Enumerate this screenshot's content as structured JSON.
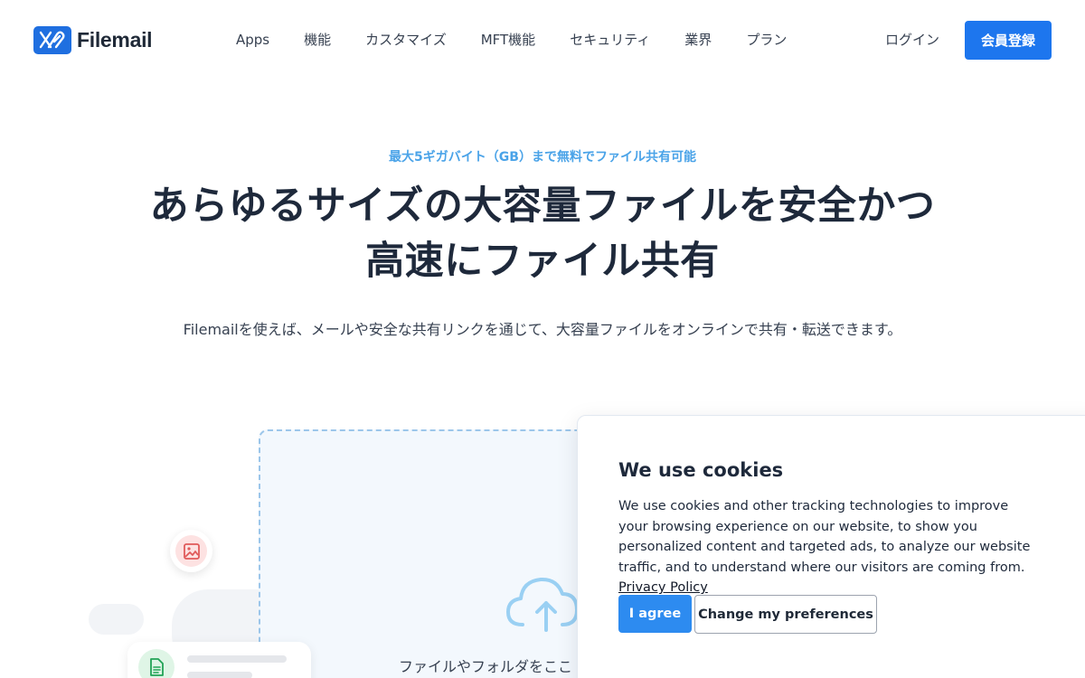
{
  "header": {
    "logo_text": "Filemail",
    "nav": [
      "Apps",
      "機能",
      "カスタマイズ",
      "MFT機能",
      "セキュリティ",
      "業界",
      "プラン"
    ],
    "login_label": "ログイン",
    "signup_label": "会員登録"
  },
  "hero": {
    "eyebrow": "最大5ギガバイト（GB）まで無料でファイル共有可能",
    "title_line1": "あらゆるサイズの大容量ファイルを安全かつ",
    "title_line2": "高速にファイル共有",
    "subtitle": "Filemailを使えば、メールや安全な共有リンクを通じて、大容量ファイルをオンラインで共有・転送できます。"
  },
  "upload": {
    "drop_text": "ファイルやフォルダをここ"
  },
  "cookie": {
    "title": "We use cookies",
    "body": "We use cookies and other tracking technologies to improve your browsing experience on our website, to show you personalized content and targeted ads, to analyze our website traffic, and to understand where our visitors are coming from.",
    "privacy_link": "Privacy Policy",
    "agree_label": "I agree",
    "prefs_label": "Change my preferences"
  },
  "colors": {
    "brand_blue": "#1d76ee",
    "eyebrow_blue": "#4aa3e8",
    "text_dark": "#1e293b"
  },
  "icons": [
    "filemail-logo-icon",
    "image-icon",
    "document-icon",
    "cloud-upload-icon"
  ]
}
